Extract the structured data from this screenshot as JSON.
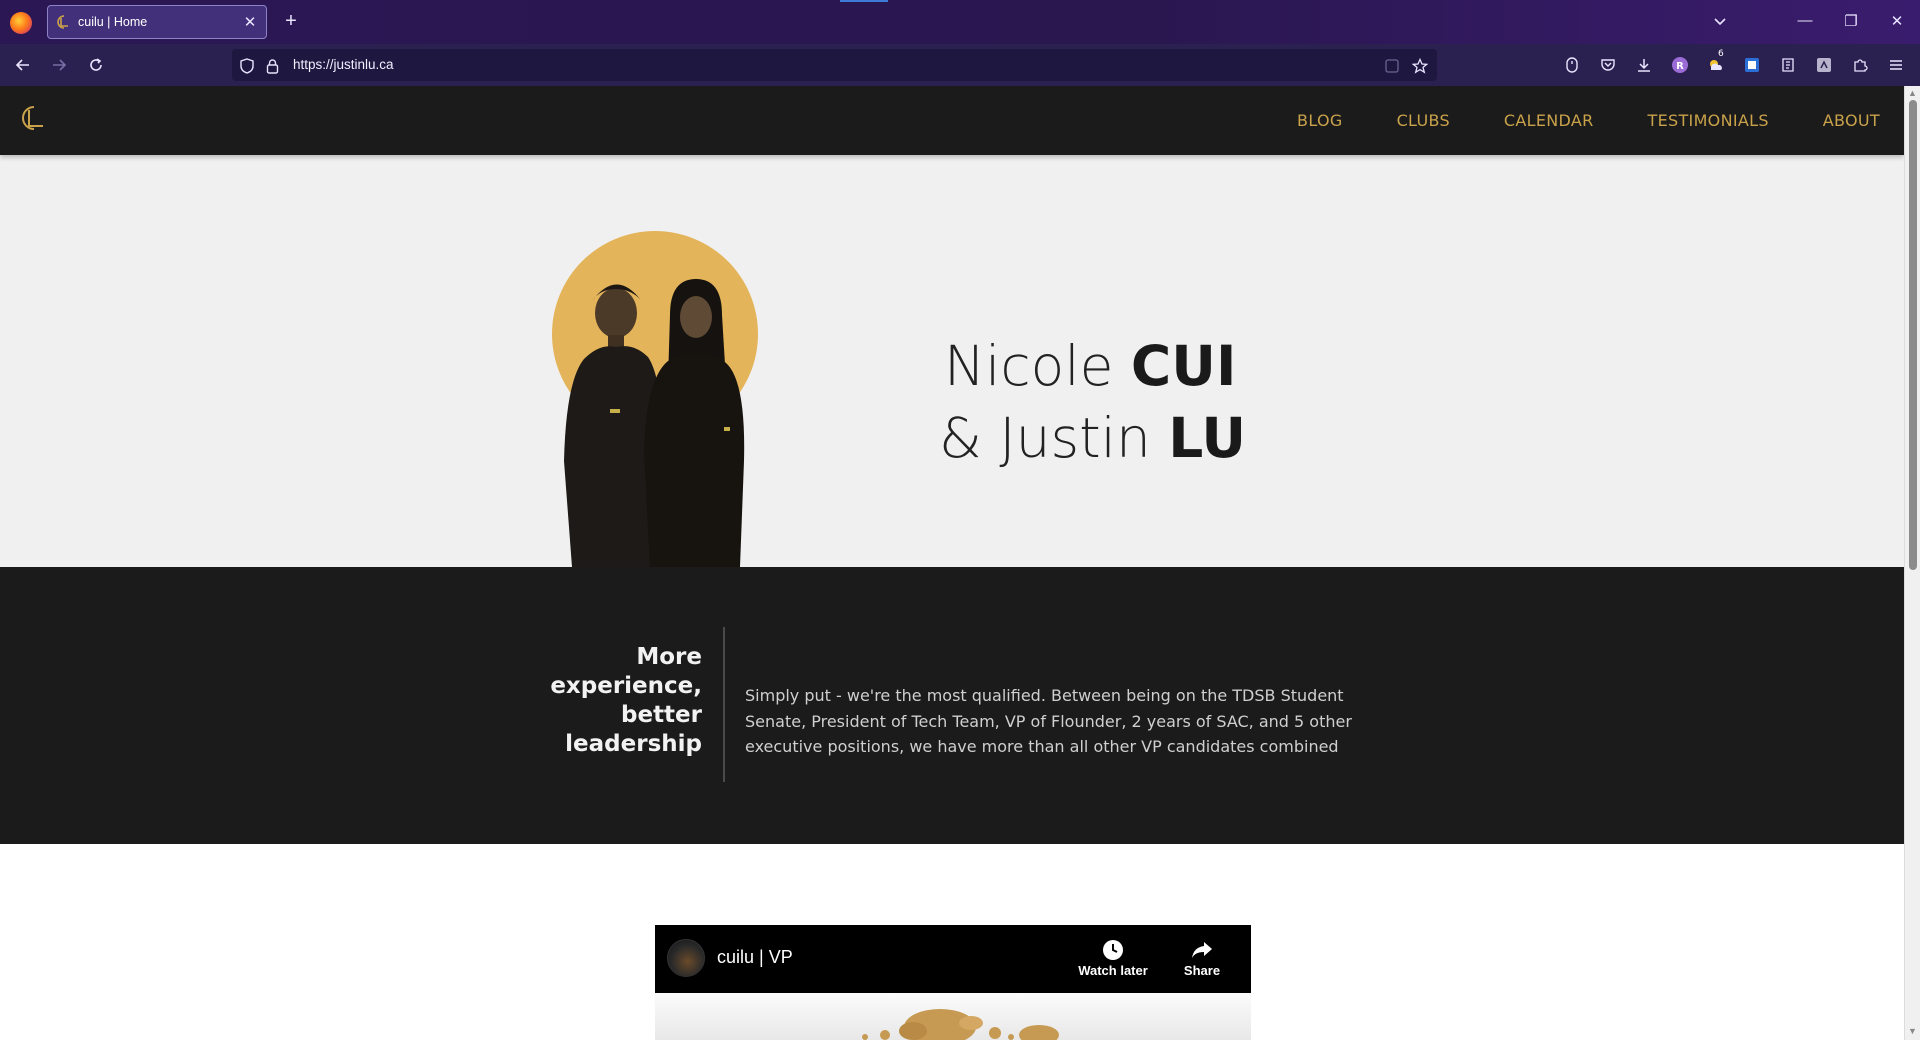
{
  "browser": {
    "tab": {
      "title": "cuilu | Home",
      "close_glyph": "✕"
    },
    "new_tab_glyph": "+",
    "url": "https://justinlu.ca",
    "window_buttons": {
      "minimize": "—",
      "restore": "❐",
      "close": "✕"
    },
    "tab_list_glyph": "⌄",
    "extension_badge": "6"
  },
  "site": {
    "nav": [
      "BLOG",
      "CLUBS",
      "CALENDAR",
      "TESTIMONIALS",
      "ABOUT"
    ],
    "accent_color": "#c9a24a"
  },
  "hero": {
    "line1_first": "Nicole",
    "line1_last": "CUI",
    "line2_first": "& Justin",
    "line2_last": "LU"
  },
  "experience": {
    "heading_lines": [
      "More",
      "experience,",
      "better",
      "leadership"
    ],
    "body": "Simply put - we're the most qualified. Between being on the TDSB Student Senate, President of Tech Team, VP of Flounder, 2 years of SAC, and 5 other executive positions, we have more than all other VP candidates combined"
  },
  "video": {
    "title": "cuilu | VP",
    "watch_later": "Watch later",
    "share": "Share"
  }
}
